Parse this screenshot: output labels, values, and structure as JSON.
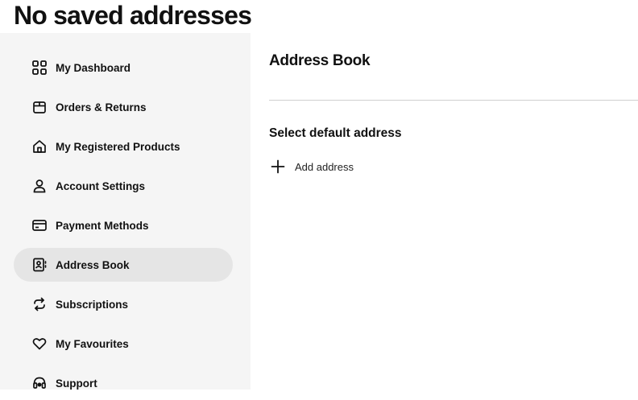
{
  "page": {
    "title": "No saved addresses"
  },
  "sidebar": {
    "items": [
      {
        "label": "My Dashboard",
        "icon": "dashboard-icon"
      },
      {
        "label": "Orders & Returns",
        "icon": "box-icon"
      },
      {
        "label": "My Registered Products",
        "icon": "home-icon"
      },
      {
        "label": "Account Settings",
        "icon": "user-icon"
      },
      {
        "label": "Payment Methods",
        "icon": "credit-card-icon"
      },
      {
        "label": "Address Book",
        "icon": "address-book-icon",
        "active": true
      },
      {
        "label": "Subscriptions",
        "icon": "refresh-icon"
      },
      {
        "label": "My Favourites",
        "icon": "heart-icon"
      },
      {
        "label": "Support",
        "icon": "headset-icon"
      }
    ]
  },
  "main": {
    "heading": "Address Book",
    "section_title": "Select default address",
    "add_address_label": "Add address"
  }
}
